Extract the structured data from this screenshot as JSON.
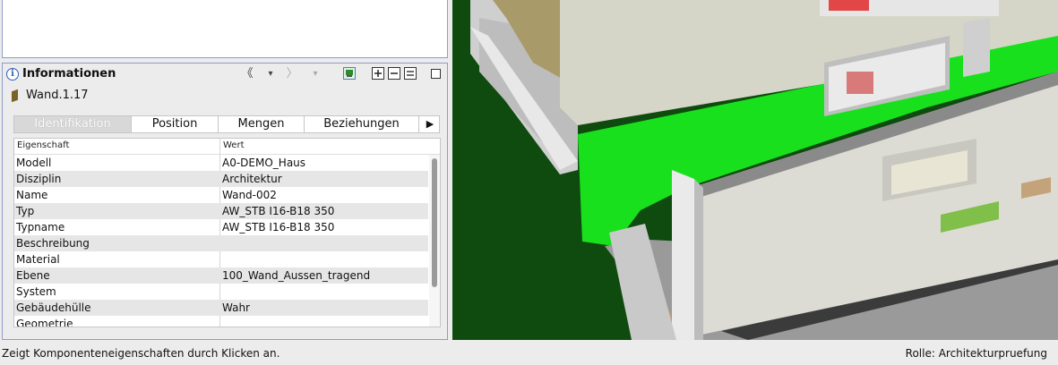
{
  "info_panel": {
    "title": "Informationen",
    "object_name": "Wand.1.17",
    "toolbar": {
      "back": "《",
      "dropdown": "▾",
      "forward": "〉",
      "dropdown2": "▾"
    },
    "tabs": [
      "Identifikation",
      "Position",
      "Mengen",
      "Beziehungen"
    ],
    "tabs_more": "▶",
    "columns": {
      "property": "Eigenschaft",
      "value": "Wert"
    },
    "rows": [
      {
        "property": "Modell",
        "value": "A0-DEMO_Haus"
      },
      {
        "property": "Disziplin",
        "value": "Architektur"
      },
      {
        "property": "Name",
        "value": "Wand-002"
      },
      {
        "property": "Typ",
        "value": "AW_STB I16-B18 350"
      },
      {
        "property": "Typname",
        "value": "AW_STB I16-B18 350"
      },
      {
        "property": "Beschreibung",
        "value": ""
      },
      {
        "property": "Material",
        "value": ""
      },
      {
        "property": "Ebene",
        "value": "100_Wand_Aussen_tragend"
      },
      {
        "property": "System",
        "value": ""
      },
      {
        "property": "Gebäudehülle",
        "value": "Wahr"
      },
      {
        "property": "Geometrie",
        "value": ""
      }
    ]
  },
  "status_bar": {
    "hint": "Zeigt Komponenteneigenschaften durch Klicken an.",
    "role": "Rolle: Architekturpruefung"
  },
  "colors": {
    "highlight_green": "#19e01c",
    "ground_green": "#0f4a0f",
    "panel_border": "#8e9cc7"
  }
}
